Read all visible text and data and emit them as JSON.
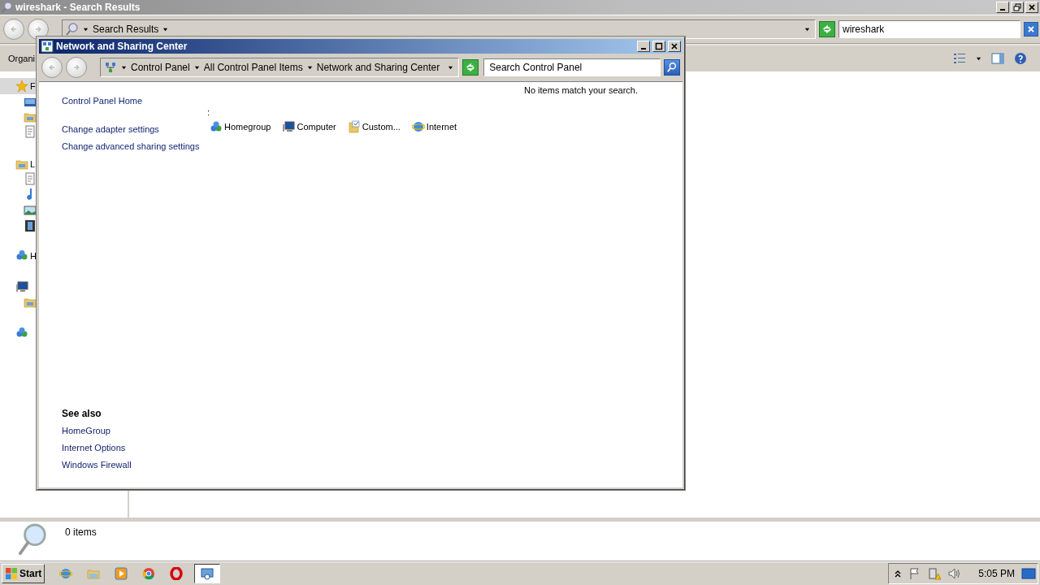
{
  "explorer": {
    "title": "wireshark - Search Results",
    "breadcrumb": "Search Results",
    "search_value": "wireshark",
    "organize": "Organi",
    "sidebar_labels": [
      "F",
      "L",
      "H"
    ],
    "status": "0 items"
  },
  "dialog": {
    "title": "Network and Sharing Center",
    "breadcrumb": [
      "Control Panel",
      "All Control Panel Items",
      "Network and Sharing Center"
    ],
    "search_placeholder": "Search Control Panel",
    "message": "No items match your search.",
    "tasks": [
      "Control Panel Home",
      "Change adapter settings",
      "Change advanced sharing settings"
    ],
    "heading": ":",
    "results": [
      "Homegroup",
      "Computer",
      "Custom...",
      "Internet"
    ],
    "see_also": {
      "title": "See also",
      "links": [
        "HomeGroup",
        "Internet Options",
        "Windows Firewall"
      ]
    }
  },
  "taskbar": {
    "start": "Start",
    "apps": [
      {
        "selected": false
      },
      {
        "selected": false
      },
      {
        "selected": false
      },
      {
        "selected": false
      },
      {
        "selected": false
      },
      {
        "selected": true
      }
    ],
    "clock": "5:05 PM"
  }
}
